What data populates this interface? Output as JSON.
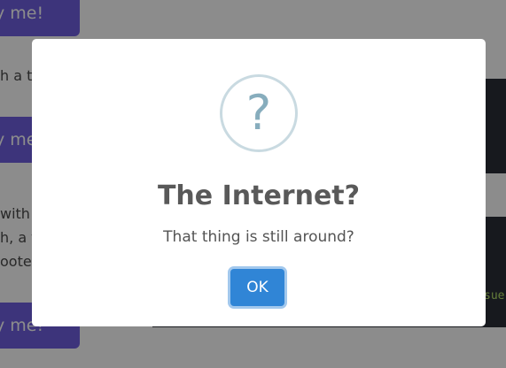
{
  "background": {
    "buttons": [
      "y me!",
      "y me!",
      "y me!"
    ],
    "texts": [
      "h a t",
      "with",
      "h, a te",
      "oote"
    ],
    "code_snippet": "sue"
  },
  "modal": {
    "icon": "question-icon",
    "icon_glyph": "?",
    "title": "The Internet?",
    "text": "That thing is still around?",
    "ok_label": "OK"
  },
  "colors": {
    "accent": "#3085d6",
    "bg_button": "#6f5fe0",
    "icon_border": "#c9dae1",
    "icon_glyph": "#87adbd",
    "overlay": "rgba(0,0,0,0.45)"
  }
}
